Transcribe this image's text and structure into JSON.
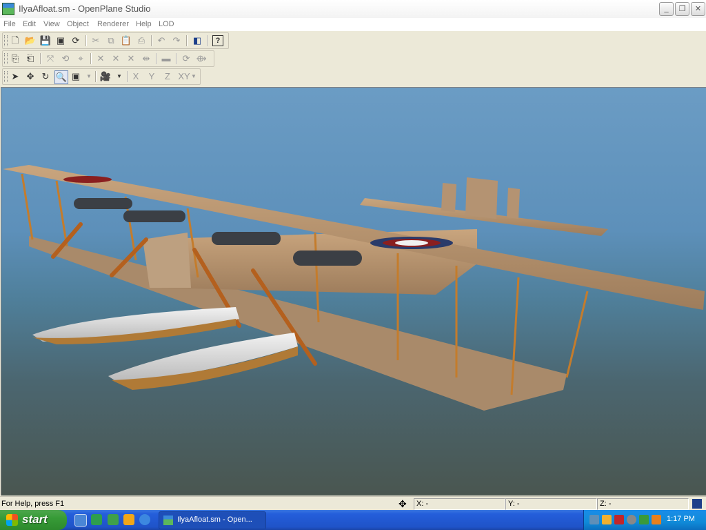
{
  "window": {
    "title": "IlyaAfloat.sm - OpenPlane Studio"
  },
  "menu": [
    "File",
    "Edit",
    "View",
    "Object",
    "Renderer",
    "Help",
    "LOD"
  ],
  "toolbar": {
    "axis_x": "X",
    "axis_y": "Y",
    "axis_z": "Z",
    "axis_xy": "XY"
  },
  "status": {
    "help": "For Help, press F1",
    "x": "X: -",
    "y": "Y: -",
    "z": "Z: -"
  },
  "taskbar": {
    "start": "start",
    "task": "IlyaAfloat.sm - Open...",
    "clock": "1:17 PM"
  },
  "colors": {
    "sky_top": "#6b9cc4",
    "ground": "#4a5650",
    "taskbar": "#245edb",
    "start": "#379b37"
  }
}
